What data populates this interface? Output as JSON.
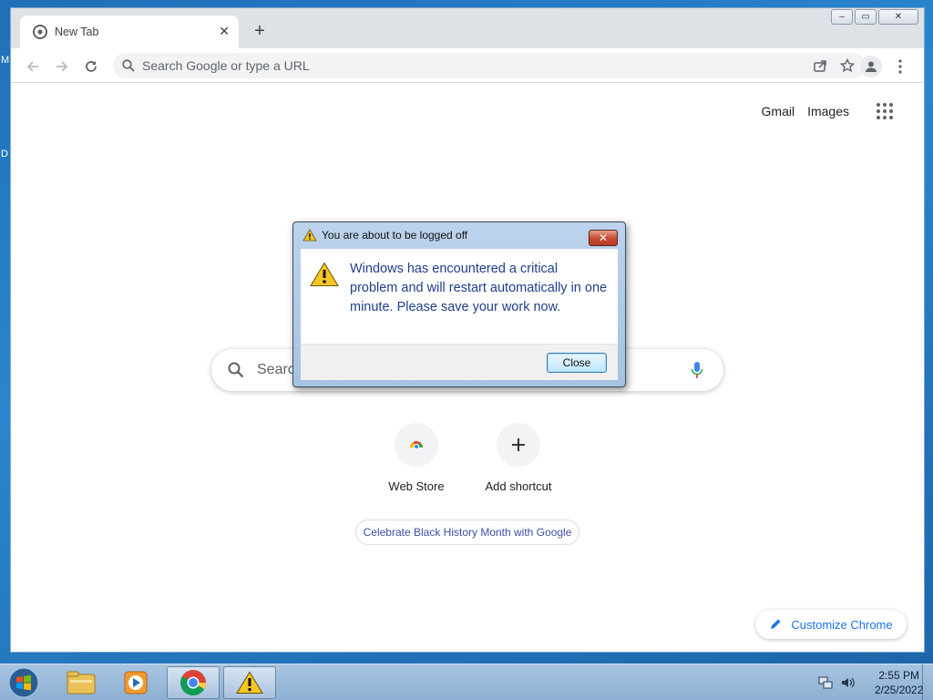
{
  "desktop": {
    "edge_letters": [
      "M",
      "D"
    ]
  },
  "browser": {
    "tab": {
      "title": "New Tab"
    },
    "window_controls": {
      "minimize": "‒",
      "restore": "▭",
      "close": "✕"
    },
    "new_tab_label": "+",
    "omnibox": {
      "placeholder": "Search Google or type a URL"
    },
    "ntp": {
      "header_links": [
        "Gmail",
        "Images"
      ],
      "search_box_text": "Searc",
      "shortcuts": [
        {
          "label": "Web Store",
          "icon": "chrome-web-store-icon"
        },
        {
          "label": "Add shortcut",
          "icon": "plus-icon"
        }
      ],
      "doodle_chip": "Celebrate Black History Month with Google",
      "customize_label": "Customize Chrome"
    }
  },
  "dialog": {
    "title": "You are about to be logged off",
    "message": "Windows has encountered a critical problem and will restart automatically in one minute. Please save your work now.",
    "close_button": "Close",
    "close_x": "✕"
  },
  "taskbar": {
    "items": [
      "windows-explorer-icon",
      "media-player-icon",
      "chrome-icon",
      "warning-icon"
    ],
    "clock": {
      "time": "2:55 PM",
      "date": "2/25/2022"
    }
  },
  "colors": {
    "accent": "#1a73e8",
    "dialog_text": "#1f3f8a",
    "taskbar": "#a8c4e0"
  }
}
